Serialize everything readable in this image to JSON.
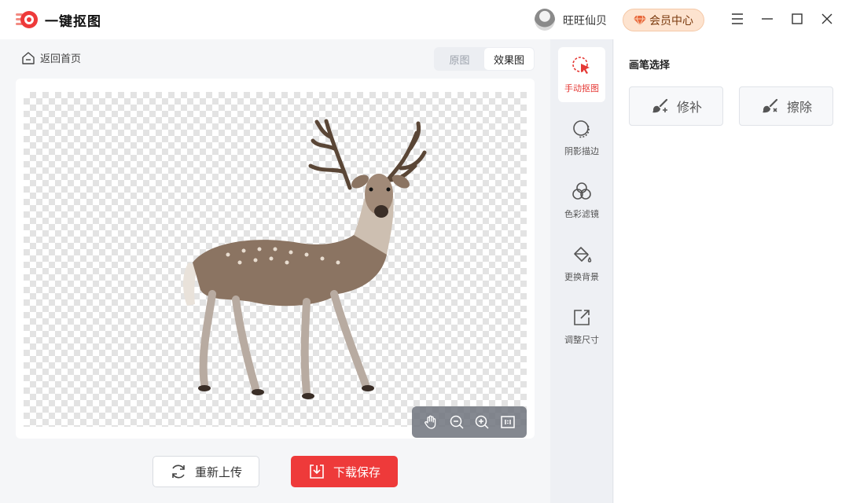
{
  "titlebar": {
    "app_title": "一键抠图",
    "username": "旺旺仙贝",
    "vip_label": "会员中心"
  },
  "nav": {
    "back_label": "返回首页"
  },
  "view_toggle": {
    "options": [
      "原图",
      "效果图"
    ],
    "selected": "效果图"
  },
  "actions": {
    "reupload_label": "重新上传",
    "download_label": "下载保存"
  },
  "tools": [
    {
      "label": "手动抠图",
      "icon": "cursor-click-icon",
      "active": true
    },
    {
      "label": "阴影描边",
      "icon": "shadow-outline-icon",
      "active": false
    },
    {
      "label": "色彩滤镜",
      "icon": "color-filter-icon",
      "active": false
    },
    {
      "label": "更换背景",
      "icon": "paint-bucket-icon",
      "active": false
    },
    {
      "label": "调整尺寸",
      "icon": "resize-icon",
      "active": false
    }
  ],
  "brush_panel": {
    "title": "画笔选择",
    "buttons": [
      {
        "label": "修补",
        "icon": "brush-repair-icon"
      },
      {
        "label": "擦除",
        "icon": "brush-erase-icon"
      }
    ]
  },
  "colors": {
    "accent": "#ee3a3a",
    "vip_bg": "#fde3cf"
  }
}
